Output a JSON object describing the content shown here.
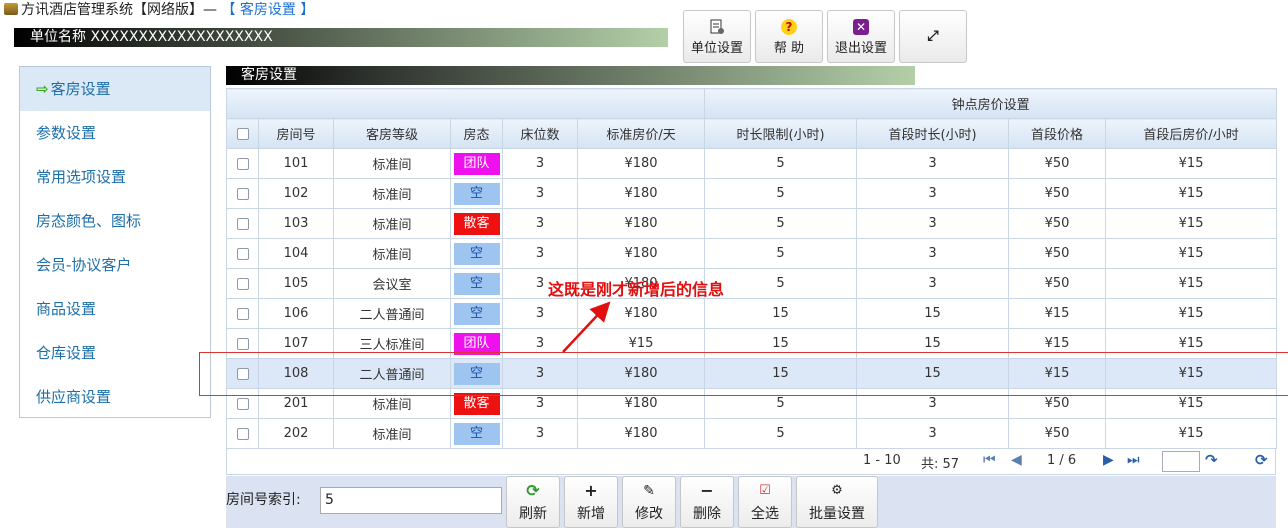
{
  "app": {
    "title_prefix": "方讯酒店管理系统【网络版】— ",
    "title_section": "【 客房设置 】",
    "unit_label": "单位名称 XXXXXXXXXXXXXXXXXXX"
  },
  "top_buttons": {
    "unit": "单位设置",
    "help": "帮 助",
    "exit": "退出设置"
  },
  "sidebar": {
    "items": [
      {
        "label": "客房设置"
      },
      {
        "label": "参数设置"
      },
      {
        "label": "常用选项设置"
      },
      {
        "label": "房态颜色、图标"
      },
      {
        "label": "会员-协议客户"
      },
      {
        "label": "商品设置"
      },
      {
        "label": "仓库设置"
      },
      {
        "label": "供应商设置"
      }
    ]
  },
  "panel": {
    "title": "客房设置"
  },
  "table": {
    "group_header": "钟点房价设置",
    "columns": [
      "房间号",
      "客房等级",
      "房态",
      "床位数",
      "标准房价/天",
      "时长限制(小时)",
      "首段时长(小时)",
      "首段价格",
      "首段后房价/小时"
    ],
    "rows": [
      {
        "room": "101",
        "level": "标准间",
        "status": "团队",
        "beds": "3",
        "price": "¥180",
        "limit": "5",
        "first_len": "3",
        "first_price": "¥50",
        "after": "¥15"
      },
      {
        "room": "102",
        "level": "标准间",
        "status": "空",
        "beds": "3",
        "price": "¥180",
        "limit": "5",
        "first_len": "3",
        "first_price": "¥50",
        "after": "¥15"
      },
      {
        "room": "103",
        "level": "标准间",
        "status": "散客",
        "beds": "3",
        "price": "¥180",
        "limit": "5",
        "first_len": "3",
        "first_price": "¥50",
        "after": "¥15"
      },
      {
        "room": "104",
        "level": "标准间",
        "status": "空",
        "beds": "3",
        "price": "¥180",
        "limit": "5",
        "first_len": "3",
        "first_price": "¥50",
        "after": "¥15"
      },
      {
        "room": "105",
        "level": "会议室",
        "status": "空",
        "beds": "3",
        "price": "¥180",
        "limit": "5",
        "first_len": "3",
        "first_price": "¥50",
        "after": "¥15"
      },
      {
        "room": "106",
        "level": "二人普通间",
        "status": "空",
        "beds": "3",
        "price": "¥180",
        "limit": "15",
        "first_len": "15",
        "first_price": "¥15",
        "after": "¥15"
      },
      {
        "room": "107",
        "level": "三人标准间",
        "status": "团队",
        "beds": "3",
        "price": "¥15",
        "limit": "15",
        "first_len": "15",
        "first_price": "¥15",
        "after": "¥15"
      },
      {
        "room": "108",
        "level": "二人普通间",
        "status": "空",
        "beds": "3",
        "price": "¥180",
        "limit": "15",
        "first_len": "15",
        "first_price": "¥15",
        "after": "¥15"
      },
      {
        "room": "201",
        "level": "标准间",
        "status": "散客",
        "beds": "3",
        "price": "¥180",
        "limit": "5",
        "first_len": "3",
        "first_price": "¥50",
        "after": "¥15"
      },
      {
        "room": "202",
        "level": "标准间",
        "status": "空",
        "beds": "3",
        "price": "¥180",
        "limit": "5",
        "first_len": "3",
        "first_price": "¥50",
        "after": "¥15"
      }
    ],
    "status_colors": {
      "团队": "#ee11ee",
      "空": "#9ec4f0",
      "散客": "#ee1111"
    }
  },
  "pager": {
    "range": "1 - 10",
    "total": "共: 57",
    "page": "1 / 6",
    "jump_value": ""
  },
  "footer": {
    "search_label": "房间号索引:",
    "search_value": "5",
    "buttons": {
      "refresh": "刷新",
      "add": "新增",
      "edit": "修改",
      "delete": "删除",
      "select_all": "全选",
      "batch": "批量设置"
    }
  },
  "annotation": {
    "text": "这既是刚才新增后的信息"
  }
}
